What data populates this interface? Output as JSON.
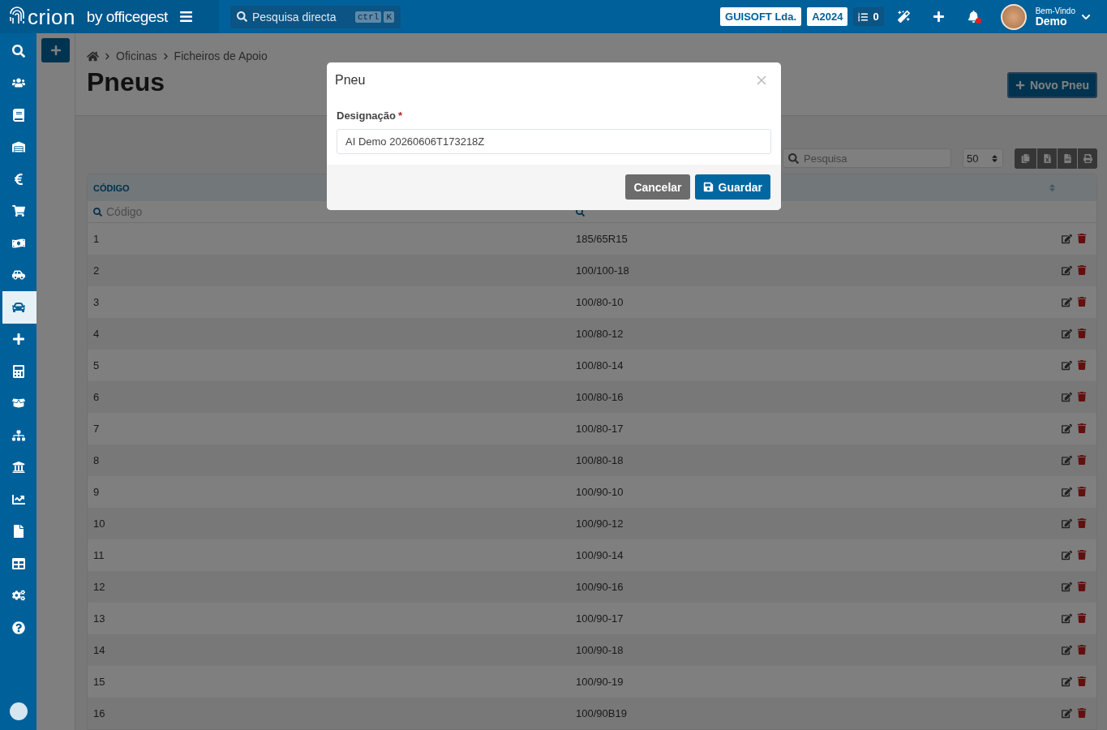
{
  "topbar": {
    "logo": "crion",
    "logo_suffix": "by officegest",
    "search": {
      "placeholder": "Pesquisa directa",
      "keys": [
        "ctrl",
        "K"
      ]
    },
    "company": "GUISOFT Lda.",
    "year": "A2024",
    "tasks_count": "0",
    "notifications_unread": true,
    "greeting": "Bem-Vindo",
    "user": "Demo"
  },
  "sidebar": {
    "items": [
      {
        "selected": false
      },
      {
        "selected": false
      },
      {
        "selected": false
      },
      {
        "selected": false
      },
      {
        "selected": false
      },
      {
        "selected": false
      },
      {
        "selected": false
      },
      {
        "selected": false
      },
      {
        "selected": true
      },
      {
        "selected": false
      },
      {
        "selected": false
      },
      {
        "selected": false
      },
      {
        "selected": false
      },
      {
        "selected": false
      },
      {
        "selected": false
      },
      {
        "selected": false
      },
      {
        "selected": false
      },
      {
        "selected": false
      },
      {
        "selected": false
      }
    ]
  },
  "breadcrumb": [
    "Oficinas",
    "Ficheiros de Apoio"
  ],
  "page": {
    "title": "Pneus",
    "new_button": "Novo Pneu"
  },
  "toolbar": {
    "search_placeholder": "Pesquisa",
    "page_size": "50"
  },
  "table": {
    "columns": [
      {
        "label": "CÓDIGO",
        "filter_placeholder": "Código"
      },
      {}
    ],
    "rows": [
      {
        "code": "1",
        "designation": "185/65R15"
      },
      {
        "code": "2",
        "designation": "100/100-18"
      },
      {
        "code": "3",
        "designation": "100/80-10"
      },
      {
        "code": "4",
        "designation": "100/80-12"
      },
      {
        "code": "5",
        "designation": "100/80-14"
      },
      {
        "code": "6",
        "designation": "100/80-16"
      },
      {
        "code": "7",
        "designation": "100/80-17"
      },
      {
        "code": "8",
        "designation": "100/80-18"
      },
      {
        "code": "9",
        "designation": "100/90-10"
      },
      {
        "code": "10",
        "designation": "100/90-12"
      },
      {
        "code": "11",
        "designation": "100/90-14"
      },
      {
        "code": "12",
        "designation": "100/90-16"
      },
      {
        "code": "13",
        "designation": "100/90-17"
      },
      {
        "code": "14",
        "designation": "100/90-18"
      },
      {
        "code": "15",
        "designation": "100/90-19"
      },
      {
        "code": "16",
        "designation": "100/90B19"
      }
    ]
  },
  "modal": {
    "title": "Pneu",
    "field_label": "Designação",
    "required_mark": "*",
    "field_value": "AI Demo 20260606T173218Z",
    "cancel": "Cancelar",
    "save": "Guardar"
  }
}
